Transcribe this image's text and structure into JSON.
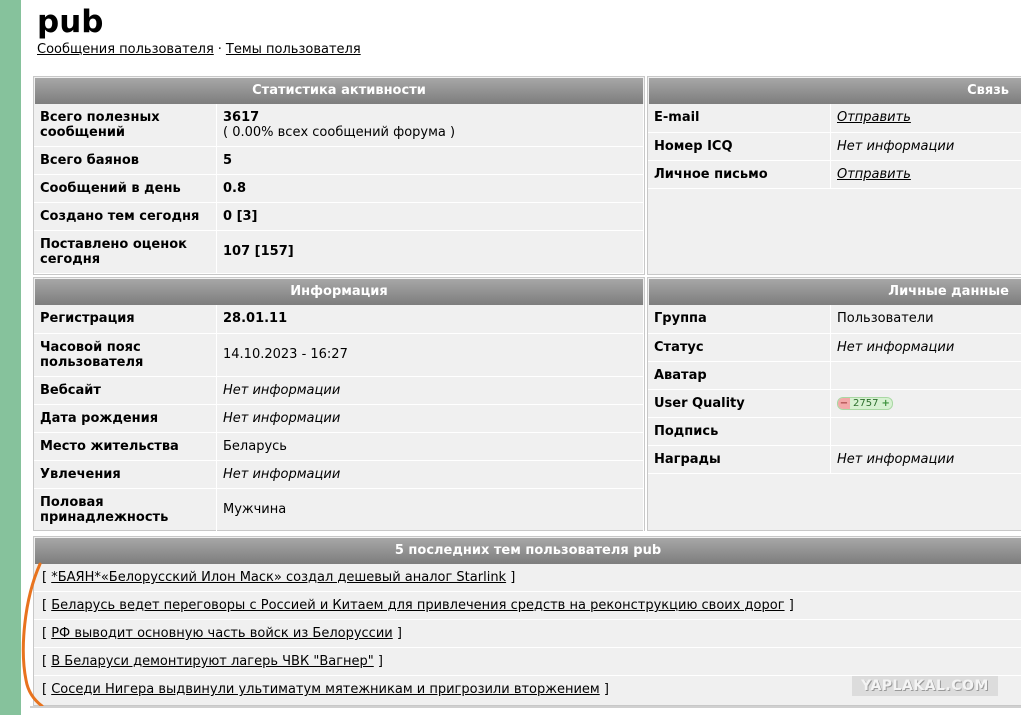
{
  "page": {
    "username": "pub",
    "link_messages": "Сообщения пользователя",
    "link_separator": "·",
    "link_topics": "Темы пользователя"
  },
  "activity": {
    "title": "Статистика активности",
    "rows": [
      {
        "label": "Всего полезных сообщений",
        "value": "3617",
        "sub": "( 0.00% всех сообщений форума )"
      },
      {
        "label": "Всего баянов",
        "value": "5"
      },
      {
        "label": "Сообщений в день",
        "value": "0.8"
      },
      {
        "label": "Создано тем сегодня",
        "value": "0 [3]"
      },
      {
        "label": "Поставлено оценок сегодня",
        "value": "107 [157]"
      }
    ]
  },
  "contact": {
    "title": "Связь",
    "rows": [
      {
        "label": "E-mail",
        "value": "Отправить"
      },
      {
        "label": "Номер ICQ",
        "value": "Нет информации"
      },
      {
        "label": "Личное письмо",
        "value": "Отправить"
      }
    ]
  },
  "info": {
    "title": "Информация",
    "rows": [
      {
        "label": "Регистрация",
        "value": "28.01.11"
      },
      {
        "label": "Часовой пояс пользователя",
        "value": "14.10.2023 - 16:27"
      },
      {
        "label": "Вебсайт",
        "value": "Нет информации"
      },
      {
        "label": "Дата рождения",
        "value": "Нет информации"
      },
      {
        "label": "Место жительства",
        "value": "Беларусь"
      },
      {
        "label": "Увлечения",
        "value": "Нет информации"
      },
      {
        "label": "Половая принадлежность",
        "value": "Мужчина"
      }
    ]
  },
  "personal": {
    "title": "Личные данные",
    "rows": [
      {
        "label": "Группа",
        "value": "Пользователи"
      },
      {
        "label": "Статус",
        "value": "Нет информации"
      },
      {
        "label": "Аватар",
        "value": ""
      },
      {
        "label": "User Quality",
        "value": "2757"
      },
      {
        "label": "Подпись",
        "value": ""
      },
      {
        "label": "Награды",
        "value": "Нет информации"
      }
    ],
    "uq_minus": "−",
    "uq_plus": "+"
  },
  "topics": {
    "title": "5 последних тем пользователя pub",
    "bracket_open": "[",
    "bracket_close": "]",
    "items": [
      "*БАЯН*«Белорусский Илон Маск» создал дешевый аналог Starlink",
      "Беларусь ведет переговоры с Россией и Китаем для привлечения средств на реконструкцию своих дорог",
      "РФ выводит основную часть войск из Белоруссии",
      "В Беларуси демонтируют лагерь ЧВК \"Вагнер\"",
      "Соседи Нигера выдвинули ультиматум мятежникам и пригрозили вторжением"
    ]
  },
  "watermark": "YAPLAKAL.COM",
  "colors": {
    "left_strip": "#86c29c",
    "header_gradient_top": "#a7a7a7",
    "header_gradient_bottom": "#7d7d7d",
    "panel_bg": "#f0f0f0",
    "annotation": "#e8731e"
  }
}
